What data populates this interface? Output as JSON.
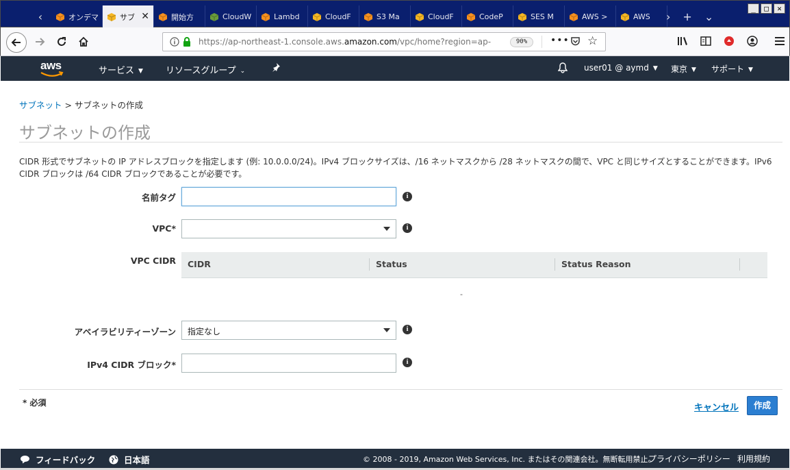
{
  "browser": {
    "tabs": [
      {
        "title": "オンデマ",
        "icon": "aws-cube-orange-icon",
        "color": "#f7901e"
      },
      {
        "title": "サブ",
        "icon": "aws-cube-yellow-icon",
        "color": "#f5b623",
        "active": true
      },
      {
        "title": "開始方",
        "icon": "aws-cube-orange-icon",
        "color": "#f7901e"
      },
      {
        "title": "CloudW",
        "icon": "cloudwatch-green-icon",
        "color": "#6a9c3a"
      },
      {
        "title": "Lambd",
        "icon": "lambda-icon",
        "color": "#f7901e"
      },
      {
        "title": "CloudF",
        "icon": "aws-cube-yellow-icon",
        "color": "#f5b623"
      },
      {
        "title": "S3 Ma",
        "icon": "aws-cube-orange-icon",
        "color": "#f7901e"
      },
      {
        "title": "CloudF",
        "icon": "aws-cube-yellow-icon",
        "color": "#f5b623"
      },
      {
        "title": "CodeP",
        "icon": "aws-cube-orange-icon",
        "color": "#f7901e"
      },
      {
        "title": "SES M",
        "icon": "aws-cube-yellow-icon",
        "color": "#f5b623"
      },
      {
        "title": "AWS >",
        "icon": "aws-cube-orange-icon",
        "color": "#f7901e"
      },
      {
        "title": "AWS",
        "icon": "aws-cube-yellow-icon",
        "color": "#f5b623"
      }
    ],
    "url_prefix": "https://ap-northeast-1.console.aws.",
    "url_domain": "amazon.com",
    "url_suffix": "/vpc/home?region=ap-",
    "zoom": "90%"
  },
  "aws_header": {
    "logo": "aws",
    "services": "サービス",
    "resource_groups": "リソースグループ",
    "user": "user01 @ aymd",
    "region": "東京",
    "support": "サポート"
  },
  "breadcrumb": {
    "parent": "サブネット",
    "separator": ">",
    "current": "サブネットの作成"
  },
  "page": {
    "title": "サブネットの作成",
    "description": "CIDR 形式でサブネットの IP アドレスブロックを指定します (例: 10.0.0.0/24)。IPv4 ブロックサイズは、/16 ネットマスクから /28 ネットマスクの間で、VPC と同じサイズとすることができます。IPv6 CIDR ブロックは /64 CIDR ブロックであることが必要です。"
  },
  "form": {
    "name_tag_label": "名前タグ",
    "name_tag_value": "",
    "vpc_label": "VPC*",
    "vpc_value": "",
    "vpc_cidr_label": "VPC CIDR",
    "az_label": "アベイラビリティーゾーン",
    "az_value": "指定なし",
    "ipv4_label": "IPv4 CIDR ブロック*",
    "ipv4_value": ""
  },
  "cidr_table": {
    "columns": [
      "CIDR",
      "Status",
      "Status Reason"
    ],
    "empty_text": "-"
  },
  "actions": {
    "required_note": "* 必須",
    "cancel": "キャンセル",
    "create": "作成"
  },
  "console_footer": {
    "feedback": "フィードバック",
    "language": "日本語",
    "copyright": "© 2008 - 2019, Amazon Web Services, Inc. またはその関連会社。無断転用禁止。",
    "privacy": "プライバシーポリシー",
    "terms": "利用規約"
  },
  "colors": {
    "aws_nav": "#232f3e",
    "link": "#0073bb",
    "primary_button": "#2b7ed1",
    "tabbar": "#0a1f6e"
  }
}
